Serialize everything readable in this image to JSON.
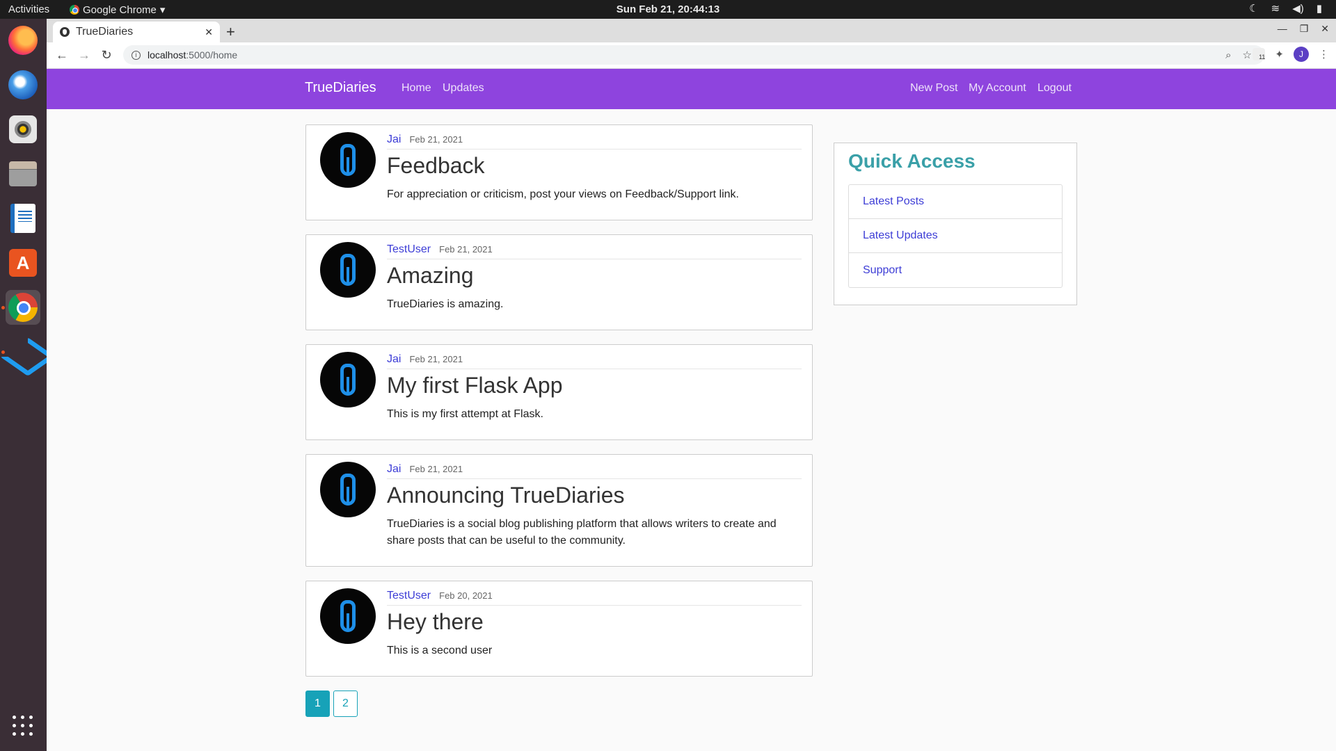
{
  "system": {
    "activities": "Activities",
    "app_name": "Google Chrome",
    "app_arrow": "▾",
    "clock": "Sun Feb 21, 20:44:13",
    "tray_icons": [
      "moon-icon",
      "wifi-icon",
      "volume-icon",
      "battery-icon"
    ]
  },
  "dock": {
    "items": [
      "firefox",
      "thunderbird",
      "rhythmbox",
      "files",
      "libreoffice-writer",
      "ubuntu-software",
      "google-chrome",
      "visual-studio-code"
    ],
    "active": "google-chrome",
    "show_apps_icon": "apps-grid-icon"
  },
  "browser": {
    "tab_title": "TrueDiaries",
    "tab_close": "✕",
    "new_tab": "+",
    "url_host": "localhost",
    "url_path": ":5000/home",
    "profile_initial": "J",
    "extension_badge": "11"
  },
  "site": {
    "brand": "TrueDiaries",
    "nav_left": [
      "Home",
      "Updates"
    ],
    "nav_right": [
      "New Post",
      "My Account",
      "Logout"
    ],
    "accent_color": "#8e44de"
  },
  "posts": [
    {
      "author": "Jai",
      "date": "Feb 21, 2021",
      "title": "Feedback",
      "content": "For appreciation or criticism, post your views on Feedback/Support link."
    },
    {
      "author": "TestUser",
      "date": "Feb 21, 2021",
      "title": "Amazing",
      "content": "TrueDiaries is amazing."
    },
    {
      "author": "Jai",
      "date": "Feb 21, 2021",
      "title": "My first Flask App",
      "content": "This is my first attempt at Flask."
    },
    {
      "author": "Jai",
      "date": "Feb 21, 2021",
      "title": "Announcing TrueDiaries",
      "content": "TrueDiaries is a social blog publishing platform that allows writers to create and share posts that can be useful to the community."
    },
    {
      "author": "TestUser",
      "date": "Feb 20, 2021",
      "title": "Hey there",
      "content": "This is a second user"
    }
  ],
  "pagination": {
    "pages": [
      "1",
      "2"
    ],
    "current": "1"
  },
  "quick_access": {
    "title": "Quick Access",
    "links": [
      "Latest Posts",
      "Latest Updates",
      "Support"
    ]
  }
}
